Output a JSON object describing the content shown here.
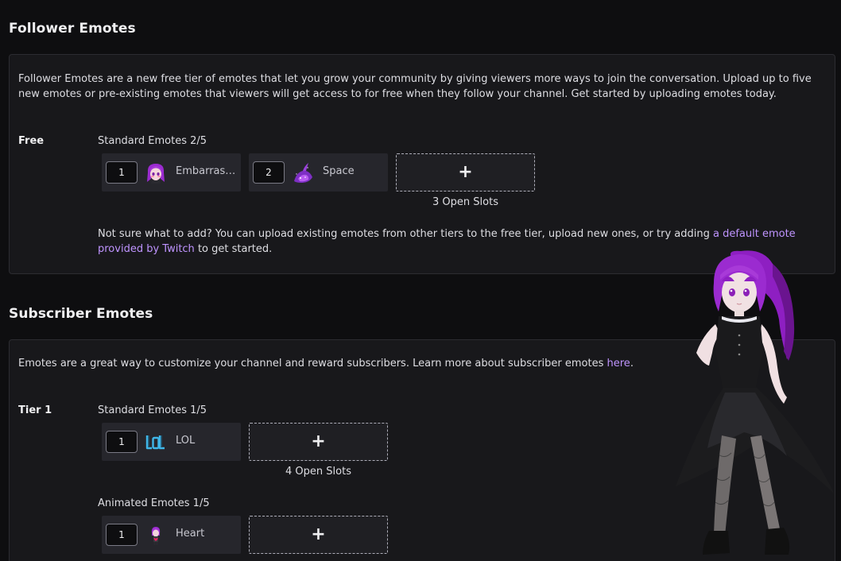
{
  "follower": {
    "title": "Follower Emotes",
    "description": "Follower Emotes are a new free tier of emotes that let you grow your community by giving viewers more ways to join the conversation. Upload up to five new emotes or pre-existing emotes that viewers will get access to for free when they follow your channel. Get started by uploading emotes today.",
    "row_label": "Free",
    "group_label": "Standard Emotes 2/5",
    "emotes": [
      {
        "order": "1",
        "name": "Embarrassed",
        "icon": "embarrassed-emote-icon"
      },
      {
        "order": "2",
        "name": "Space",
        "icon": "space-emote-icon"
      }
    ],
    "add_label": "+",
    "open_slots": "3 Open Slots",
    "hint_prefix": "Not sure what to add? You can upload existing emotes from other tiers to the free tier, upload new ones, or try adding",
    "hint_link": "a default emote provided by Twitch",
    "hint_suffix": "to get started."
  },
  "subscriber": {
    "title": "Subscriber Emotes",
    "description_prefix": "Emotes are a great way to customize your channel and reward subscribers. Learn more about subscriber emotes",
    "description_link": "here",
    "description_suffix": ".",
    "tier_label": "Tier 1",
    "standard": {
      "group_label": "Standard Emotes 1/5",
      "emotes": [
        {
          "order": "1",
          "name": "LOL",
          "icon": "lol-emote-icon"
        }
      ],
      "add_label": "+",
      "open_slots": "4 Open Slots"
    },
    "animated": {
      "group_label": "Animated Emotes 1/5",
      "emotes": [
        {
          "order": "1",
          "name": "Heart",
          "icon": "heart-emote-icon"
        }
      ],
      "add_label": "+"
    }
  },
  "colors": {
    "background": "#0e0e10",
    "card": "#18181b",
    "link": "#bf94ff",
    "emote_tile": "#26262c"
  }
}
